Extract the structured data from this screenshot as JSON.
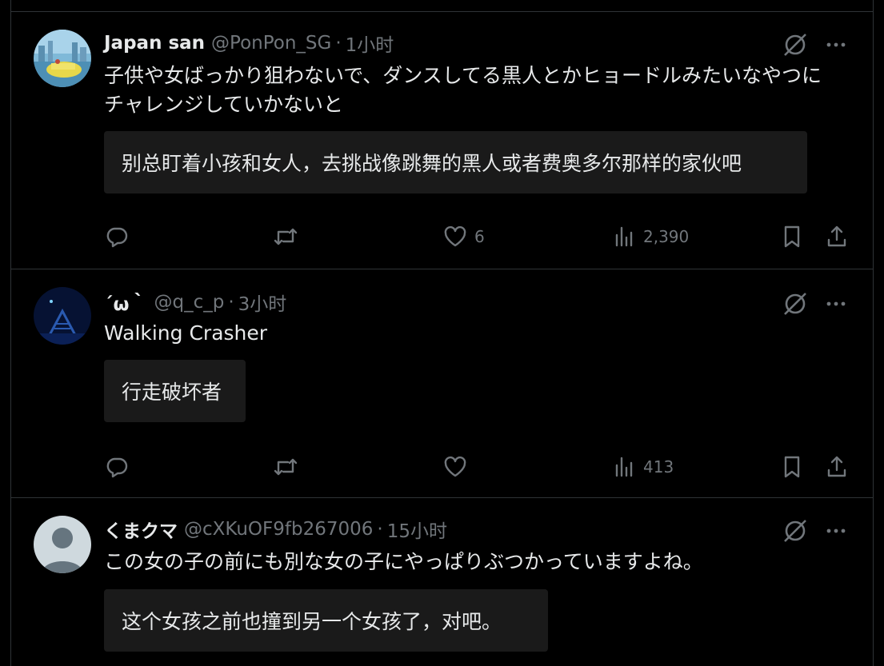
{
  "posts": [
    {
      "name": "Japan san",
      "handle": "@PonPon_SG",
      "separator": "·",
      "time": "1小时",
      "text": "子供や女ばっかり狙わないで、ダンスしてる黒人とかヒョードルみたいなやつにチャレンジしていかないと",
      "translation": "别总盯着小孩和女人，去挑战像跳舞的黑人或者费奥多尔那样的家伙吧",
      "likes": "6",
      "views": "2,390"
    },
    {
      "name": "´ω｀",
      "handle": "@q_c_p",
      "separator": "·",
      "time": "3小时",
      "text": "Walking Crasher",
      "translation": "行走破坏者",
      "likes": "",
      "views": "413"
    },
    {
      "name": "くまクマ",
      "handle": "@cXKuOF9fb267006",
      "separator": "·",
      "time": "15小时",
      "text": "この女の子の前にも別な女の子にやっぱりぶつかっていますよね。",
      "translation": "这个女孩之前也撞到另一个女孩了，对吧。",
      "likes": "",
      "views": ""
    }
  ],
  "icons": {
    "grok": "grok-icon",
    "more": "more-icon",
    "reply": "reply-icon",
    "retweet": "retweet-icon",
    "like": "heart-icon",
    "views": "views-icon",
    "bookmark": "bookmark-icon",
    "share": "share-icon"
  },
  "colors": {
    "background": "#000000",
    "text": "#e7e9ea",
    "muted": "#71767b",
    "border": "#2f3336",
    "translation_bg": "#1a1a1a"
  }
}
